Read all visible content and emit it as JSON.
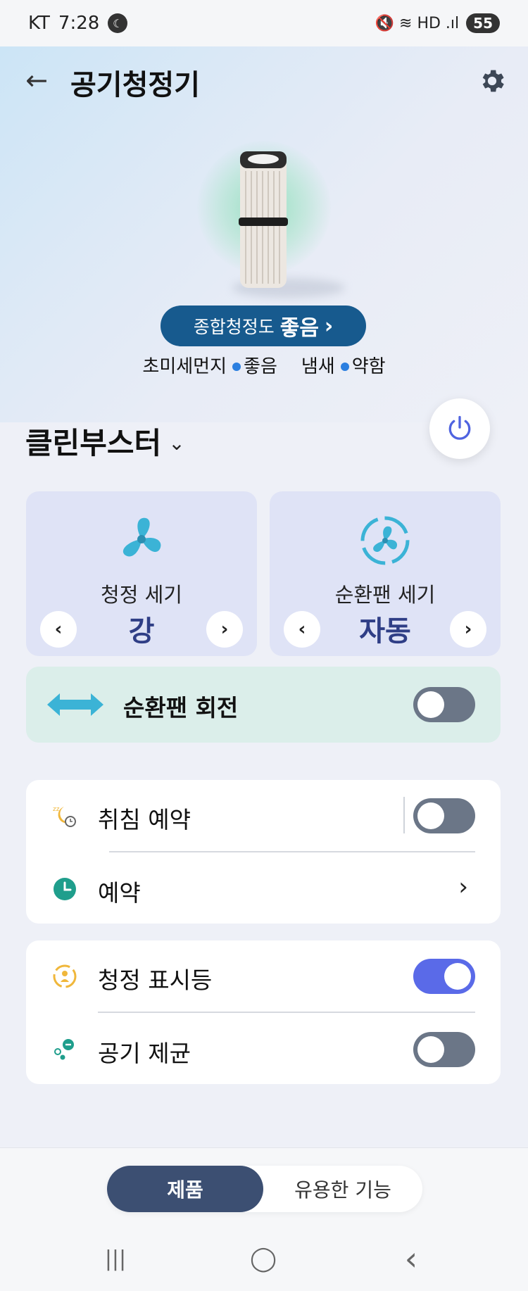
{
  "status_bar": {
    "carrier": "KT",
    "time": "7:28",
    "moon_glyph": "☾",
    "icons_text": "🔇 ≋ HD .ıl",
    "battery": "55"
  },
  "header": {
    "title": "공기청정기",
    "back_glyph": "←"
  },
  "product": {
    "overall_label": "종합청정도",
    "overall_value": "좋음",
    "overall_chevron": "›",
    "fine_dust_label": "초미세먼지",
    "fine_dust_value": "좋음",
    "odor_label": "냄새",
    "odor_value": "약함",
    "accent": "#2b7fe0"
  },
  "mode": {
    "label": "클린부스터",
    "chevron": "⌄"
  },
  "fans": [
    {
      "title": "청정 세기",
      "value": "강",
      "prev": "‹",
      "next": "›",
      "icon": "fan-icon"
    },
    {
      "title": "순환팬 세기",
      "value": "자동",
      "prev": "‹",
      "next": "›",
      "icon": "circulation-fan-icon"
    }
  ],
  "rotation": {
    "label": "순환팬 회전",
    "on": false
  },
  "settings_group1": [
    {
      "label": "취침 예약",
      "icon": "sleep-icon",
      "type": "toggle",
      "on": false
    },
    {
      "label": "예약",
      "icon": "clock-icon",
      "type": "link",
      "chevron": "›"
    }
  ],
  "settings_group2": [
    {
      "label": "청정 표시등",
      "icon": "indicator-light-icon",
      "type": "toggle",
      "on": true
    },
    {
      "label": "공기 제균",
      "icon": "sterilize-icon",
      "type": "toggle",
      "on": false
    }
  ],
  "bottom_tabs": {
    "active": "제품",
    "inactive": "유용한 기능"
  },
  "navbar": {
    "recent": "|||",
    "home": "◯",
    "back": "‹"
  },
  "colors": {
    "toggle_on": "#5a6ae8",
    "toggle_off": "#6b7687",
    "pill_bg": "#175a8e",
    "fan_value": "#2f3e86",
    "active_tab": "#3c4f72"
  }
}
